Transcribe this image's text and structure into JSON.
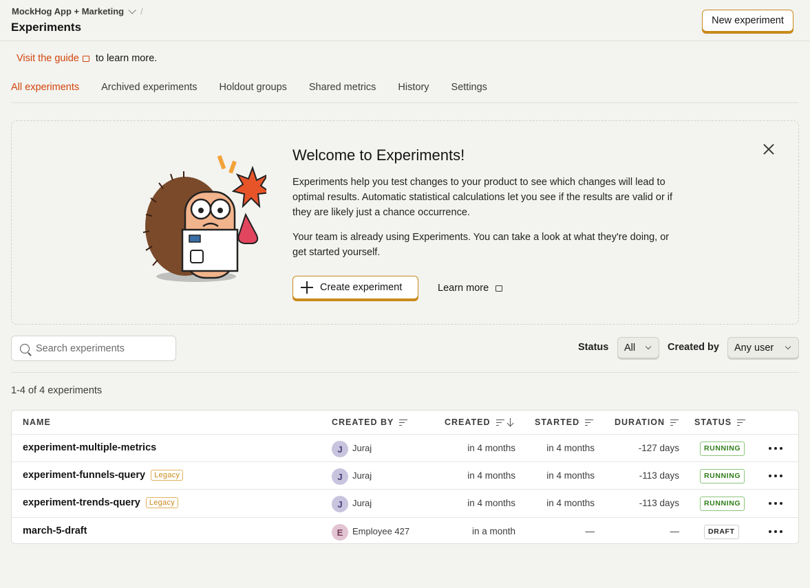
{
  "header": {
    "project": "MockHog App + Marketing",
    "separator": "/",
    "title": "Experiments",
    "new_button": "New experiment"
  },
  "guide": {
    "link": "Visit the guide",
    "rest": "to learn more."
  },
  "tabs": [
    {
      "label": "All experiments",
      "active": true
    },
    {
      "label": "Archived experiments",
      "active": false
    },
    {
      "label": "Holdout groups",
      "active": false
    },
    {
      "label": "Shared metrics",
      "active": false
    },
    {
      "label": "History",
      "active": false
    },
    {
      "label": "Settings",
      "active": false
    }
  ],
  "welcome": {
    "title": "Welcome to Experiments!",
    "p1": "Experiments help you test changes to your product to see which changes will lead to optimal results. Automatic statistical calculations let you see if the results are valid or if they are likely just a chance occurrence.",
    "p2": "Your team is already using Experiments. You can take a look at what they're doing, or get started yourself.",
    "create_button": "Create experiment",
    "learn_more": "Learn more"
  },
  "search": {
    "placeholder": "Search experiments",
    "value": ""
  },
  "filters": {
    "status_label": "Status",
    "status_value": "All",
    "created_by_label": "Created by",
    "created_by_value": "Any user"
  },
  "count": "1-4 of 4 experiments",
  "table": {
    "headers": {
      "name": "NAME",
      "created_by": "CREATED BY",
      "created": "CREATED",
      "started": "STARTED",
      "duration": "DURATION",
      "status": "STATUS"
    },
    "rows": [
      {
        "name": "experiment-multiple-metrics",
        "legacy": "",
        "initial": "J",
        "creator": "Juraj",
        "created": "in 4 months",
        "started": "in 4 months",
        "duration": "-127 days",
        "status": "RUNNING"
      },
      {
        "name": "experiment-funnels-query",
        "legacy": "Legacy",
        "initial": "J",
        "creator": "Juraj",
        "created": "in 4 months",
        "started": "in 4 months",
        "duration": "-113 days",
        "status": "RUNNING"
      },
      {
        "name": "experiment-trends-query",
        "legacy": "Legacy",
        "initial": "J",
        "creator": "Juraj",
        "created": "in 4 months",
        "started": "in 4 months",
        "duration": "-113 days",
        "status": "RUNNING"
      },
      {
        "name": "march-5-draft",
        "legacy": "",
        "initial": "E",
        "creator": "Employee 427",
        "created": "in a month",
        "started": "—",
        "duration": "—",
        "status": "DRAFT"
      }
    ]
  },
  "colors": {
    "accent": "#d2450c",
    "button_border": "#c98a1b",
    "running": "#2f7d19",
    "background": "#f3f3ef"
  }
}
